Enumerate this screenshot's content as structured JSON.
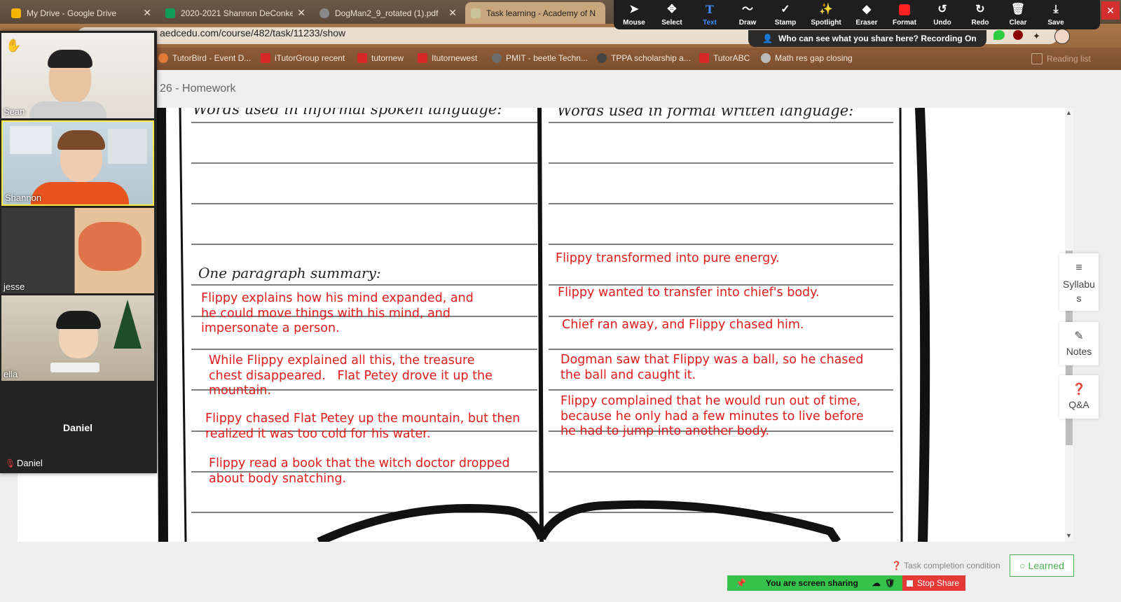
{
  "tabs": [
    {
      "title": "My Drive - Google Drive",
      "color": "#f4b400"
    },
    {
      "title": "2020-2021 Shannon DeConke",
      "color": "#0f9d58"
    },
    {
      "title": "DogMan2_9_rotated (1).pdf",
      "color": "#888888"
    },
    {
      "title": "Task learning - Academy of N",
      "color": "#c9c39a"
    }
  ],
  "address": {
    "url": "aedcedu.com/course/482/task/11233/show"
  },
  "bookmarks": [
    {
      "label": "TutorBird - Event D...",
      "color": "#e07b39"
    },
    {
      "label": "iTutorGroup recent",
      "color": "#d62828"
    },
    {
      "label": "tutornew",
      "color": "#d62828"
    },
    {
      "label": "Itutornewest",
      "color": "#d62828"
    },
    {
      "label": "PMIT - beetle Techn...",
      "color": "#6d6d6d"
    },
    {
      "label": "TPPA scholarship a...",
      "color": "#444444"
    },
    {
      "label": "TutorABC",
      "color": "#d62828"
    },
    {
      "label": "Math res gap closing",
      "color": "#999999"
    }
  ],
  "reading_list": "Reading list",
  "annotate_tools": [
    {
      "label": "Mouse",
      "icon": "cursor-icon"
    },
    {
      "label": "Select",
      "icon": "move-icon"
    },
    {
      "label": "Text",
      "icon": "text-icon"
    },
    {
      "label": "Draw",
      "icon": "draw-icon"
    },
    {
      "label": "Stamp",
      "icon": "check-icon"
    },
    {
      "label": "Spotlight",
      "icon": "spotlight-icon"
    },
    {
      "label": "Eraser",
      "icon": "eraser-icon"
    },
    {
      "label": "Format",
      "icon": "format-icon"
    },
    {
      "label": "Undo",
      "icon": "undo-icon"
    },
    {
      "label": "Redo",
      "icon": "redo-icon"
    },
    {
      "label": "Clear",
      "icon": "trash-icon"
    },
    {
      "label": "Save",
      "icon": "save-icon"
    }
  ],
  "share_banner": "Who can see what you share here? Recording On",
  "page_title": "26 - Homework",
  "worksheet": {
    "left_header": "Words used in informal spoken language:",
    "right_header": "Words used in formal written language:",
    "summary_label": "One paragraph summary:",
    "left_notes": [
      "Flippy explains how his mind expanded, and\nhe could move things with his mind, and\nimpersonate a person.",
      "While Flippy explained all this, the treasure\nchest disappeared.   Flat Petey drove it up the\nmountain.",
      "Flippy chased Flat Petey up the mountain, but then\nrealized it was too cold for his water.",
      "Flippy read a book that the witch doctor dropped\nabout body snatching."
    ],
    "right_notes": [
      "Flippy transformed into pure energy.",
      "Flippy wanted to transfer into chief's body.",
      "Chief ran away, and Flippy chased him.",
      "Dogman saw that Flippy was a ball, so he chased\nthe ball and caught it.",
      "Flippy complained that he would run out of time,\nbecause he only had a few minutes to live before\nhe had to jump into another body."
    ]
  },
  "side_buttons": [
    {
      "label": "Syllabu\ns",
      "icon": "menu-icon"
    },
    {
      "label": "Notes",
      "icon": "pencil-icon"
    },
    {
      "label": "Q&A",
      "icon": "question-icon"
    }
  ],
  "participants": [
    {
      "name": "Sean"
    },
    {
      "name": "Shannon"
    },
    {
      "name": "jesse"
    },
    {
      "name": "ella"
    },
    {
      "name": "Daniel",
      "video_off": true,
      "muted": true
    }
  ],
  "task_condition": "Task completion condition",
  "learned_label": "Learned",
  "sharing_text": "You are screen sharing",
  "stop_share": "Stop Share"
}
